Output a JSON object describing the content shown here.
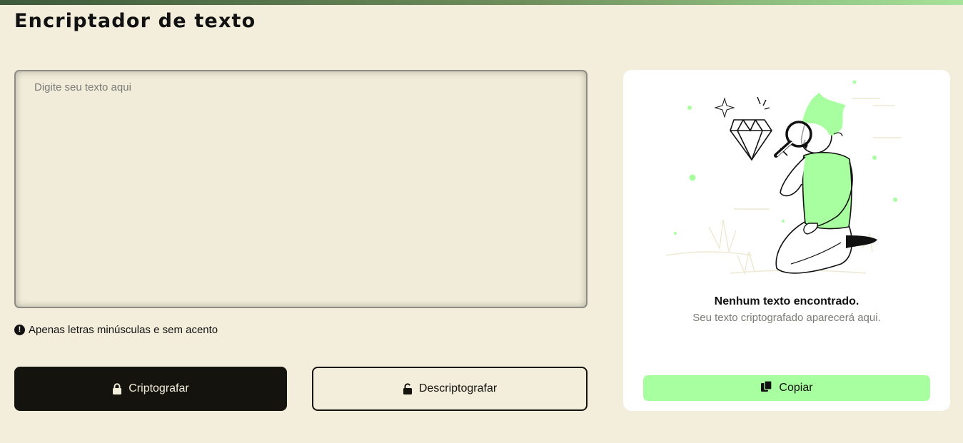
{
  "app": {
    "title": "Encriptador de texto"
  },
  "colors": {
    "background": "#f3eddb",
    "dark": "#14130d",
    "accent": "#a8ffa0",
    "panel": "#ffffff"
  },
  "input": {
    "placeholder": "Digite seu texto aqui",
    "value": ""
  },
  "hint": {
    "icon": "exclamation-circle-icon",
    "text": "Apenas letras minúsculas e sem acento"
  },
  "actions": {
    "encrypt": {
      "label": "Criptografar",
      "icon": "lock-closed-icon"
    },
    "decrypt": {
      "label": "Descriptografar",
      "icon": "lock-open-icon"
    }
  },
  "output": {
    "illustration": "person-magnifying-glass-diamond-illustration",
    "empty_title": "Nenhum texto encontrado.",
    "empty_subtitle": "Seu texto criptografado aparecerá aqui.",
    "copy": {
      "label": "Copiar",
      "icon": "copy-icon"
    }
  }
}
